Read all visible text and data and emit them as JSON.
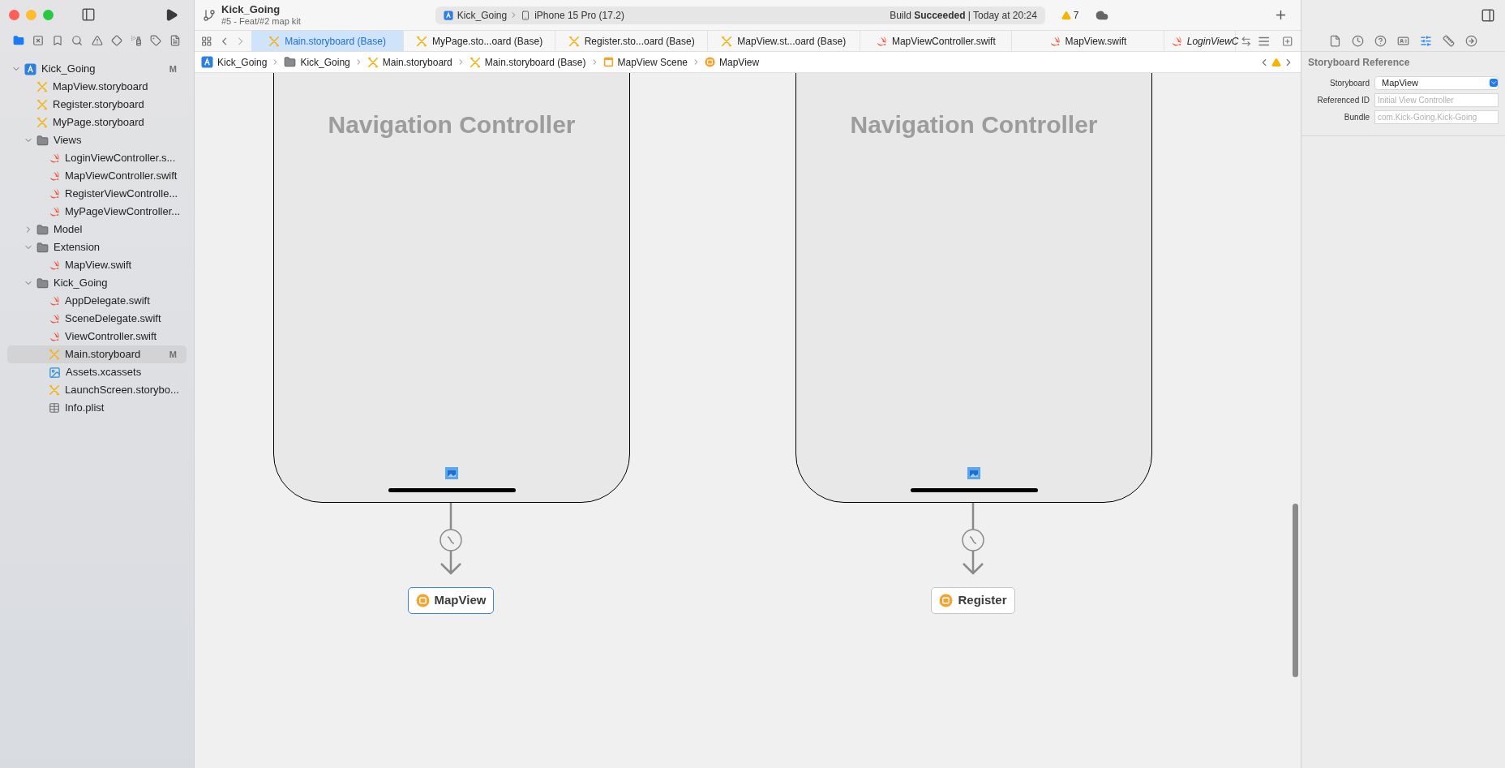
{
  "window": {
    "title": "Kick_Going",
    "subtitle": "#5 - Feat/#2 map kit"
  },
  "toolbar": {
    "scheme": "Kick_Going",
    "device": "iPhone 15 Pro (17.2)",
    "status": "Build **Succeeded** | Today at 20:24",
    "warnings": "7"
  },
  "navigator_tabs": [
    {
      "kind": "files",
      "selected": true
    },
    {
      "kind": "source",
      "selected": false
    },
    {
      "kind": "bookmarks",
      "selected": false
    },
    {
      "kind": "find",
      "selected": false
    },
    {
      "kind": "issues",
      "selected": false
    },
    {
      "kind": "tests",
      "selected": false
    },
    {
      "kind": "debug",
      "selected": false
    },
    {
      "kind": "breakpoints",
      "selected": false
    },
    {
      "kind": "reports",
      "selected": false
    }
  ],
  "tree": [
    {
      "label": "Kick_Going",
      "kind": "project",
      "status": "M",
      "selected": false,
      "expanded": true,
      "children": [
        {
          "label": "MapView.storyboard",
          "kind": "storyboard",
          "selected": false
        },
        {
          "label": "Register.storyboard",
          "kind": "storyboard",
          "selected": false
        },
        {
          "label": "MyPage.storyboard",
          "kind": "storyboard",
          "selected": false
        },
        {
          "label": "Views",
          "kind": "folder",
          "selected": false,
          "expanded": true,
          "children": [
            {
              "label": "LoginViewController.s...",
              "kind": "swift",
              "selected": false
            },
            {
              "label": "MapViewController.swift",
              "kind": "swift",
              "selected": false
            },
            {
              "label": "RegisterViewControlle...",
              "kind": "swift",
              "selected": false
            },
            {
              "label": "MyPageViewController...",
              "kind": "swift",
              "selected": false
            }
          ]
        },
        {
          "label": "Model",
          "kind": "folder",
          "selected": false,
          "expanded": false
        },
        {
          "label": "Extension",
          "kind": "folder",
          "selected": false,
          "expanded": true,
          "children": [
            {
              "label": "MapView.swift",
              "kind": "swift",
              "selected": false
            }
          ]
        },
        {
          "label": "Kick_Going",
          "kind": "folder",
          "selected": false,
          "expanded": true,
          "children": [
            {
              "label": "AppDelegate.swift",
              "kind": "swift",
              "selected": false
            },
            {
              "label": "SceneDelegate.swift",
              "kind": "swift",
              "selected": false
            },
            {
              "label": "ViewController.swift",
              "kind": "swift",
              "selected": false
            },
            {
              "label": "Main.storyboard",
              "kind": "storyboard",
              "status": "M",
              "selected": true
            },
            {
              "label": "Assets.xcassets",
              "kind": "assets",
              "selected": false
            },
            {
              "label": "LaunchScreen.storybo...",
              "kind": "storyboard",
              "selected": false
            },
            {
              "label": "Info.plist",
              "kind": "plist",
              "selected": false
            }
          ]
        }
      ]
    }
  ],
  "editor_tabs": [
    {
      "label": "Main.storyboard (Base)",
      "kind": "storyboard",
      "selected": true,
      "preview": false
    },
    {
      "label": "MyPage.sto...oard (Base)",
      "kind": "storyboard",
      "selected": false,
      "preview": false
    },
    {
      "label": "Register.sto...oard (Base)",
      "kind": "storyboard",
      "selected": false,
      "preview": false
    },
    {
      "label": "MapView.st...oard (Base)",
      "kind": "storyboard",
      "selected": false,
      "preview": false
    },
    {
      "label": "MapViewController.swift",
      "kind": "swift",
      "selected": false,
      "preview": false
    },
    {
      "label": "MapView.swift",
      "kind": "swift",
      "selected": false,
      "preview": false
    },
    {
      "label": "LoginViewC",
      "kind": "swift",
      "selected": false,
      "preview": true
    }
  ],
  "breadcrumb": [
    {
      "label": "Kick_Going",
      "kind": "project"
    },
    {
      "label": "Kick_Going",
      "kind": "folder"
    },
    {
      "label": "Main.storyboard",
      "kind": "storyboard"
    },
    {
      "label": "Main.storyboard (Base)",
      "kind": "storyboard"
    },
    {
      "label": "MapView Scene",
      "kind": "scene"
    },
    {
      "label": "MapView",
      "kind": "reference"
    }
  ],
  "canvas": {
    "scenes": [
      {
        "title": "Navigation Controller",
        "reference": "MapView",
        "selected": true
      },
      {
        "title": "Navigation Controller",
        "reference": "Register",
        "selected": false
      }
    ]
  },
  "inspector": {
    "tabs": [
      {
        "kind": "file",
        "selected": false
      },
      {
        "kind": "history",
        "selected": false
      },
      {
        "kind": "help",
        "selected": false
      },
      {
        "kind": "identity",
        "selected": false
      },
      {
        "kind": "attributes",
        "selected": true
      },
      {
        "kind": "size",
        "selected": false
      },
      {
        "kind": "connections",
        "selected": false
      }
    ],
    "section": "Storyboard Reference",
    "fields": [
      {
        "label": "Storyboard",
        "kind": "popup",
        "value": "MapView"
      },
      {
        "label": "Referenced ID",
        "kind": "text",
        "placeholder": "Initial View Controller"
      },
      {
        "label": "Bundle",
        "kind": "text",
        "placeholder": "com.Kick-Going.Kick-Going"
      }
    ]
  }
}
